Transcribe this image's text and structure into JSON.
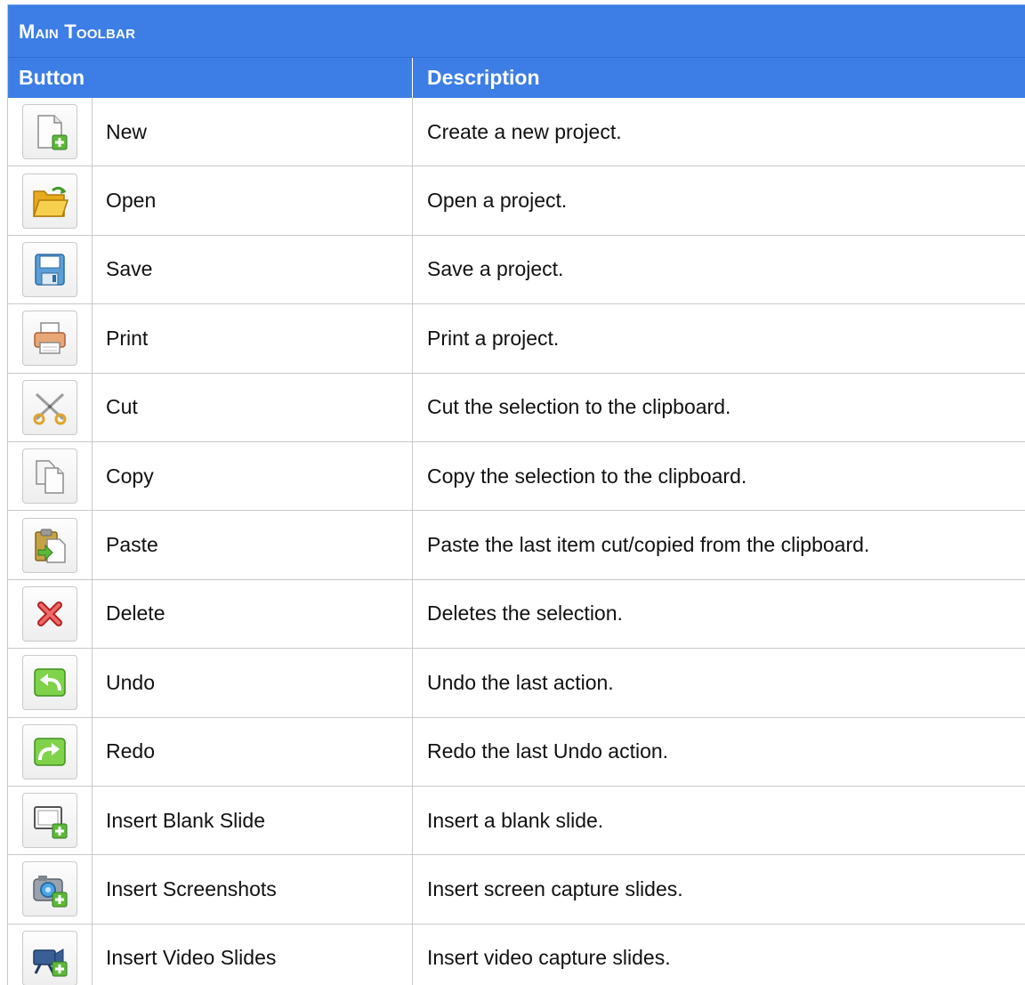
{
  "table": {
    "title": "Main Toolbar",
    "header_button": "Button",
    "header_description": "Description",
    "rows": [
      {
        "icon": "new-document-icon",
        "name": "New",
        "description": "Create a new project."
      },
      {
        "icon": "open-folder-icon",
        "name": "Open",
        "description": "Open a project."
      },
      {
        "icon": "save-disk-icon",
        "name": "Save",
        "description": "Save a project."
      },
      {
        "icon": "printer-icon",
        "name": "Print",
        "description": "Print a project."
      },
      {
        "icon": "scissors-icon",
        "name": "Cut",
        "description": "Cut the selection to the clipboard."
      },
      {
        "icon": "copy-icon",
        "name": "Copy",
        "description": "Copy the selection to the clipboard."
      },
      {
        "icon": "paste-clipboard-icon",
        "name": "Paste",
        "description": "Paste the last item cut/copied from the clipboard."
      },
      {
        "icon": "delete-x-icon",
        "name": "Delete",
        "description": "Deletes the selection."
      },
      {
        "icon": "undo-arrow-icon",
        "name": "Undo",
        "description": "Undo the last action."
      },
      {
        "icon": "redo-arrow-icon",
        "name": "Redo",
        "description": "Redo the last Undo action."
      },
      {
        "icon": "insert-blank-slide-icon",
        "name": "Insert Blank Slide",
        "description": "Insert a blank slide."
      },
      {
        "icon": "insert-screenshot-camera-icon",
        "name": "Insert Screenshots",
        "description": "Insert screen capture slides."
      },
      {
        "icon": "insert-video-camera-icon",
        "name": "Insert Video Slides",
        "description": "Insert video capture slides."
      }
    ]
  },
  "colors": {
    "header_blue": "#3d7ee6",
    "grid_gray": "#c8c8c8",
    "plus_green": "#5db83a"
  }
}
